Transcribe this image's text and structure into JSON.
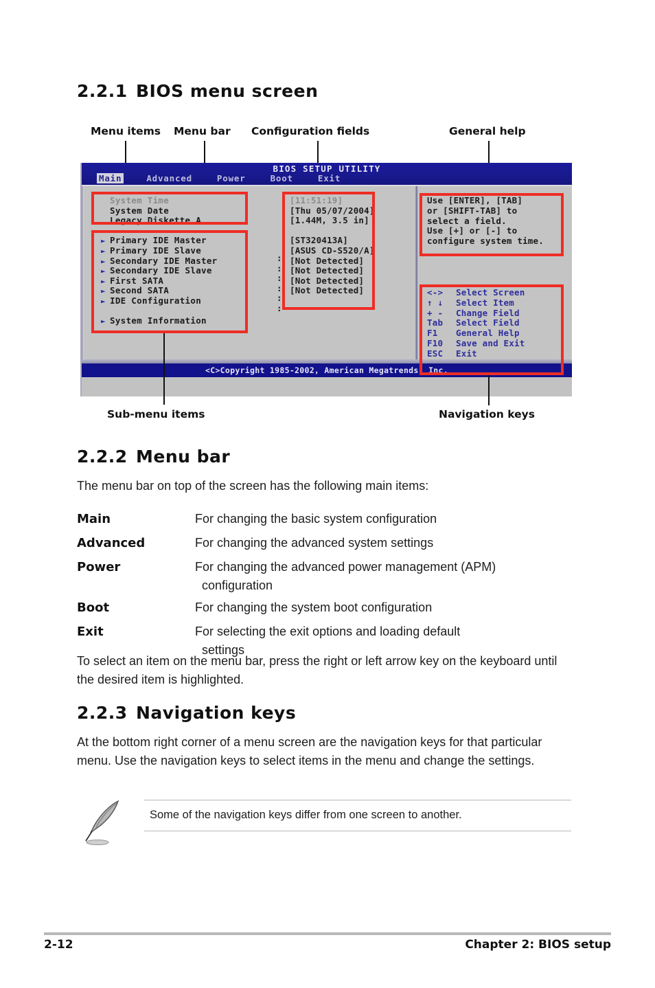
{
  "sections": {
    "s1": {
      "num": "2.2.1",
      "title": "BIOS menu screen"
    },
    "s2": {
      "num": "2.2.2",
      "title": "Menu bar"
    },
    "s3": {
      "num": "2.2.3",
      "title": "Navigation keys"
    }
  },
  "callouts": {
    "menu_items": "Menu items",
    "menu_bar": "Menu bar",
    "config_fields": "Configuration fields",
    "general_help": "General help",
    "submenu_items": "Sub-menu items",
    "navigation_keys": "Navigation keys"
  },
  "bios": {
    "title": "BIOS SETUP UTILITY",
    "tabs": [
      {
        "label": "Main",
        "selected": true
      },
      {
        "label": "Advanced",
        "selected": false
      },
      {
        "label": "Power",
        "selected": false
      },
      {
        "label": "Boot",
        "selected": false
      },
      {
        "label": "Exit",
        "selected": false
      }
    ],
    "menu_items": [
      {
        "label": "System Time",
        "arrow": false,
        "dim": true
      },
      {
        "label": "System Date",
        "arrow": false,
        "dim": false
      },
      {
        "label": "Legacy Diskette A",
        "arrow": false,
        "dim": false
      },
      {
        "label": "",
        "arrow": false,
        "dim": false
      },
      {
        "label": "Primary IDE Master",
        "arrow": true,
        "dim": false
      },
      {
        "label": "Primary IDE Slave",
        "arrow": true,
        "dim": false
      },
      {
        "label": "Secondary IDE Master",
        "arrow": true,
        "dim": false
      },
      {
        "label": "Secondary IDE Slave",
        "arrow": true,
        "dim": false
      },
      {
        "label": "First SATA",
        "arrow": true,
        "dim": false
      },
      {
        "label": "Second SATA",
        "arrow": true,
        "dim": false
      },
      {
        "label": "IDE Configuration",
        "arrow": true,
        "dim": false
      },
      {
        "label": "",
        "arrow": false,
        "dim": false
      },
      {
        "label": "System Information",
        "arrow": true,
        "dim": false
      }
    ],
    "config_values": [
      {
        "value": "[11:51:19]",
        "dim": true
      },
      {
        "value": "[Thu 05/07/2004]",
        "dim": false
      },
      {
        "value": "[1.44M, 3.5 in]",
        "dim": false
      },
      {
        "value": "",
        "dim": false
      },
      {
        "value": "[ST320413A]",
        "dim": false
      },
      {
        "value": "[ASUS CD-S520/A]",
        "dim": false
      },
      {
        "value": "[Not Detected]",
        "dim": false
      },
      {
        "value": "[Not Detected]",
        "dim": false
      },
      {
        "value": "[Not Detected]",
        "dim": false
      },
      {
        "value": "[Not Detected]",
        "dim": false
      }
    ],
    "colons": [
      ":",
      ":",
      ":",
      ":",
      ":",
      ":"
    ],
    "help_lines": [
      "Use [ENTER], [TAB]",
      "or [SHIFT-TAB] to",
      "select a field.",
      "Use [+]  or [-] to",
      "configure system time."
    ],
    "nav_keys": [
      {
        "key": "<->",
        "action": "Select Screen"
      },
      {
        "key": "↑ ↓",
        "action": "Select Item"
      },
      {
        "key": "+ -",
        "action": "Change Field"
      },
      {
        "key": "Tab",
        "action": "Select Field"
      },
      {
        "key": "F1",
        "action": "General Help"
      },
      {
        "key": "F10",
        "action": "Save and Exit"
      },
      {
        "key": "ESC",
        "action": "Exit"
      }
    ],
    "copyright": "<C>Copyright 1985-2002, American Megatrends, Inc.",
    "colors": {
      "title_bar": "#19198f",
      "panel": "#c4c4c4",
      "nav_key_text": "#2f2f9e",
      "annotation_box": "#ee2d24"
    }
  },
  "menu_bar_section": {
    "intro": "The menu bar on top of the screen has the following main items:",
    "items": [
      {
        "term": "Main",
        "desc": "For changing the basic system configuration",
        "cont": ""
      },
      {
        "term": "Advanced",
        "desc": "For changing the advanced system settings",
        "cont": ""
      },
      {
        "term": "Power",
        "desc": "For changing the advanced power management (APM)",
        "cont": "configuration"
      },
      {
        "term": "Boot",
        "desc": "For changing the system boot configuration",
        "cont": ""
      },
      {
        "term": "Exit",
        "desc": "For selecting the exit options and loading default",
        "cont": "settings"
      }
    ],
    "outro": "To select an item on the menu bar, press the right or left arrow key on the keyboard until the desired item is highlighted."
  },
  "navigation_keys_section": {
    "body": "At the bottom right corner of a menu screen are the navigation keys for that particular menu. Use the navigation keys to select items in the menu and change the settings."
  },
  "note": {
    "text": "Some of the navigation keys differ from one screen to another."
  },
  "footer": {
    "page": "2-12",
    "chapter": "Chapter 2: BIOS setup"
  }
}
